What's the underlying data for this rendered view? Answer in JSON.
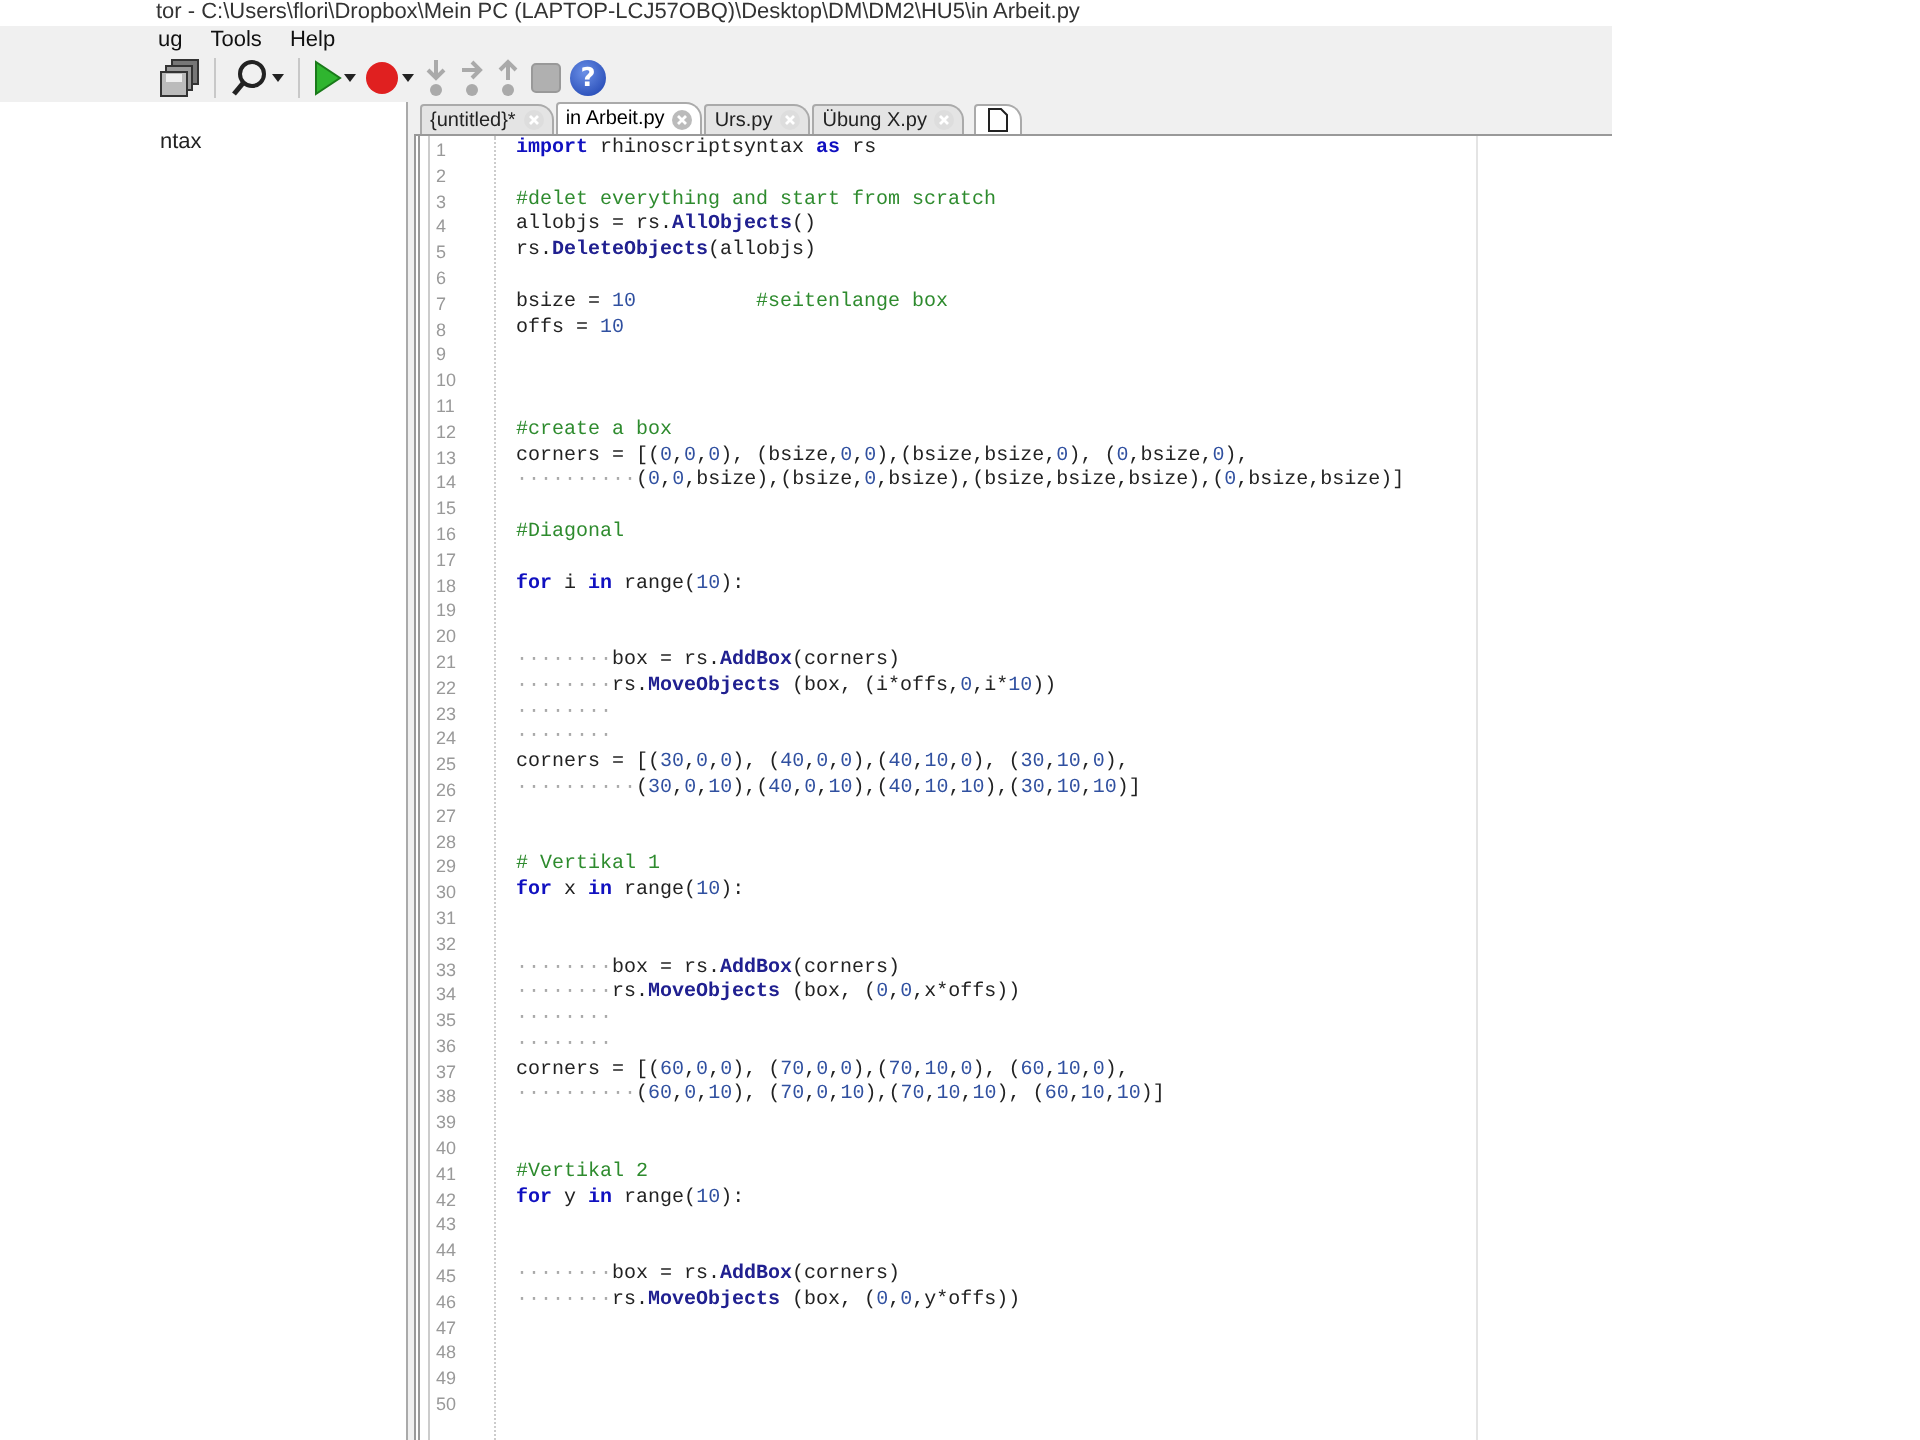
{
  "window": {
    "title": "tor - C:\\Users\\flori\\Dropbox\\Mein PC (LAPTOP-LCJ57OBQ)\\Desktop\\DM\\DM2\\HU5\\in Arbeit.py"
  },
  "menu": [
    "ug",
    "Tools",
    "Help"
  ],
  "toolbar": [
    {
      "kind": "save"
    },
    {
      "kind": "sep"
    },
    {
      "kind": "search",
      "dropdown": true
    },
    {
      "kind": "sep"
    },
    {
      "kind": "run",
      "dropdown": true
    },
    {
      "kind": "record",
      "dropdown": true
    },
    {
      "kind": "step-into"
    },
    {
      "kind": "step-over"
    },
    {
      "kind": "step-out"
    },
    {
      "kind": "stop"
    },
    {
      "kind": "help",
      "glyph": "?"
    }
  ],
  "sidebar": {
    "items": [
      "ntax"
    ]
  },
  "tabs": [
    {
      "label": "{untitled}*",
      "selected": false
    },
    {
      "label": "in Arbeit.py",
      "selected": true
    },
    {
      "label": "Urs.py",
      "selected": false
    },
    {
      "label": "Übung X.py",
      "selected": false
    }
  ],
  "editor": {
    "lines": [
      {
        "number": "1",
        "tokens": [
          {
            "kind": "kw",
            "text": "import"
          },
          {
            "kind": "code",
            "text": " rhinoscriptsyntax "
          },
          {
            "kind": "kw",
            "text": "as"
          },
          {
            "kind": "code",
            "text": " rs"
          }
        ]
      },
      {
        "number": "2"
      },
      {
        "number": "3",
        "tokens": [
          {
            "kind": "cm",
            "text": "#delet everything and start from scratch"
          }
        ]
      },
      {
        "number": "4",
        "tokens": [
          {
            "kind": "code",
            "text": "allobjs = rs."
          },
          {
            "kind": "fn",
            "text": "AllObjects"
          },
          {
            "kind": "code",
            "text": "()"
          }
        ]
      },
      {
        "number": "5",
        "tokens": [
          {
            "kind": "code",
            "text": "rs."
          },
          {
            "kind": "fn",
            "text": "DeleteObjects"
          },
          {
            "kind": "code",
            "text": "(allobjs)"
          }
        ]
      },
      {
        "number": "6"
      },
      {
        "number": "7",
        "tokens": [
          {
            "kind": "code",
            "text": "bsize = 10          "
          },
          {
            "kind": "cm",
            "text": "#seitenlange box"
          }
        ]
      },
      {
        "number": "8",
        "tokens": [
          {
            "kind": "code",
            "text": "offs = 10"
          }
        ]
      },
      {
        "number": "9"
      },
      {
        "number": "10"
      },
      {
        "number": "11"
      },
      {
        "number": "12",
        "tokens": [
          {
            "kind": "cm",
            "text": "#create a box"
          }
        ]
      },
      {
        "number": "13",
        "tokens": [
          {
            "kind": "code",
            "text": "corners = [(0,0,0), (bsize,0,0),(bsize,bsize,0), (0,bsize,0),"
          }
        ]
      },
      {
        "number": "14",
        "tokens": [
          {
            "kind": "ws",
            "text": "··········"
          },
          {
            "kind": "code",
            "text": "(0,0,bsize),(bsize,0,bsize),(bsize,bsize,bsize),(0,bsize,bsize)]"
          }
        ]
      },
      {
        "number": "15"
      },
      {
        "number": "16",
        "tokens": [
          {
            "kind": "cm",
            "text": "#Diagonal"
          }
        ]
      },
      {
        "number": "17"
      },
      {
        "number": "18",
        "tokens": [
          {
            "kind": "kw",
            "text": "for"
          },
          {
            "kind": "code",
            "text": " i "
          },
          {
            "kind": "kw",
            "text": "in"
          },
          {
            "kind": "code",
            "text": " range(10):"
          }
        ]
      },
      {
        "number": "19"
      },
      {
        "number": "20"
      },
      {
        "number": "21",
        "tokens": [
          {
            "kind": "ws",
            "text": "········"
          },
          {
            "kind": "code",
            "text": "box = rs."
          },
          {
            "kind": "fn",
            "text": "AddBox"
          },
          {
            "kind": "code",
            "text": "(corners)"
          }
        ]
      },
      {
        "number": "22",
        "tokens": [
          {
            "kind": "ws",
            "text": "········"
          },
          {
            "kind": "code",
            "text": "rs."
          },
          {
            "kind": "fn",
            "text": "MoveObjects"
          },
          {
            "kind": "code",
            "text": " (box, (i*offs,0,i*10))"
          }
        ]
      },
      {
        "number": "23",
        "tokens": [
          {
            "kind": "ws",
            "text": "········"
          }
        ]
      },
      {
        "number": "24",
        "tokens": [
          {
            "kind": "ws",
            "text": "········"
          }
        ]
      },
      {
        "number": "25",
        "tokens": [
          {
            "kind": "code",
            "text": "corners = [(30,0,0), (40,0,0),(40,10,0), (30,10,0),"
          }
        ]
      },
      {
        "number": "26",
        "tokens": [
          {
            "kind": "ws",
            "text": "··········"
          },
          {
            "kind": "code",
            "text": "(30,0,10),(40,0,10),(40,10,10),(30,10,10)]"
          }
        ]
      },
      {
        "number": "27"
      },
      {
        "number": "28"
      },
      {
        "number": "29",
        "tokens": [
          {
            "kind": "cm",
            "text": "# Vertikal 1"
          }
        ]
      },
      {
        "number": "30",
        "tokens": [
          {
            "kind": "kw",
            "text": "for"
          },
          {
            "kind": "code",
            "text": " x "
          },
          {
            "kind": "kw",
            "text": "in"
          },
          {
            "kind": "code",
            "text": " range(10):"
          }
        ]
      },
      {
        "number": "31"
      },
      {
        "number": "32"
      },
      {
        "number": "33",
        "tokens": [
          {
            "kind": "ws",
            "text": "········"
          },
          {
            "kind": "code",
            "text": "box = rs."
          },
          {
            "kind": "fn",
            "text": "AddBox"
          },
          {
            "kind": "code",
            "text": "(corners)"
          }
        ]
      },
      {
        "number": "34",
        "tokens": [
          {
            "kind": "ws",
            "text": "········"
          },
          {
            "kind": "code",
            "text": "rs."
          },
          {
            "kind": "fn",
            "text": "MoveObjects"
          },
          {
            "kind": "code",
            "text": " (box, (0,0,x*offs))"
          }
        ]
      },
      {
        "number": "35",
        "tokens": [
          {
            "kind": "ws",
            "text": "········"
          }
        ]
      },
      {
        "number": "36",
        "tokens": [
          {
            "kind": "ws",
            "text": "········"
          }
        ]
      },
      {
        "number": "37",
        "tokens": [
          {
            "kind": "code",
            "text": "corners = [(60,0,0), (70,0,0),(70,10,0), (60,10,0),"
          }
        ]
      },
      {
        "number": "38",
        "tokens": [
          {
            "kind": "ws",
            "text": "··········"
          },
          {
            "kind": "code",
            "text": "(60,0,10), (70,0,10),(70,10,10), (60,10,10)]"
          }
        ]
      },
      {
        "number": "39"
      },
      {
        "number": "40"
      },
      {
        "number": "41",
        "tokens": [
          {
            "kind": "cm",
            "text": "#Vertikal 2"
          }
        ]
      },
      {
        "number": "42",
        "tokens": [
          {
            "kind": "kw",
            "text": "for"
          },
          {
            "kind": "code",
            "text": " y "
          },
          {
            "kind": "kw",
            "text": "in"
          },
          {
            "kind": "code",
            "text": " range(10):"
          }
        ]
      },
      {
        "number": "43"
      },
      {
        "number": "44"
      },
      {
        "number": "45",
        "tokens": [
          {
            "kind": "ws",
            "text": "········"
          },
          {
            "kind": "code",
            "text": "box = rs."
          },
          {
            "kind": "fn",
            "text": "AddBox"
          },
          {
            "kind": "code",
            "text": "(corners)"
          }
        ]
      },
      {
        "number": "46",
        "tokens": [
          {
            "kind": "ws",
            "text": "········"
          },
          {
            "kind": "code",
            "text": "rs."
          },
          {
            "kind": "fn",
            "text": "MoveObjects"
          },
          {
            "kind": "code",
            "text": " (box, (0,0,y*offs))"
          }
        ]
      },
      {
        "number": "47"
      },
      {
        "number": "48"
      },
      {
        "number": "49"
      },
      {
        "number": "50"
      }
    ]
  }
}
